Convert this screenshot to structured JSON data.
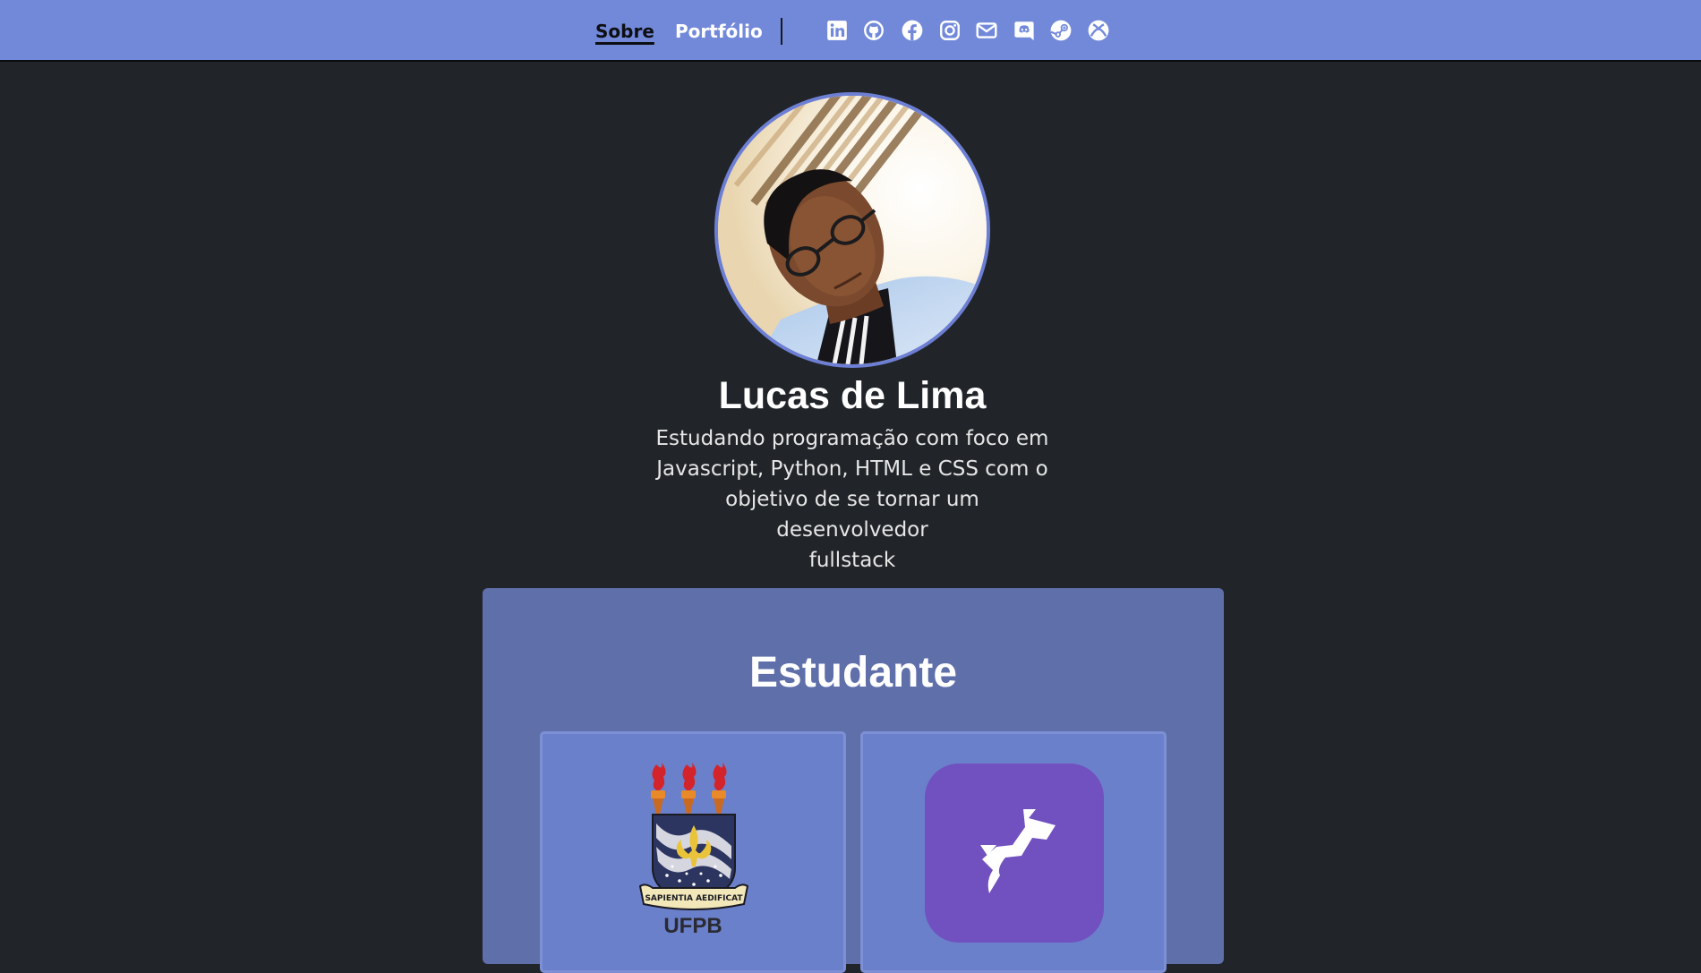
{
  "nav": {
    "links": [
      {
        "label": "Sobre",
        "active": true
      },
      {
        "label": "Portfólio",
        "active": false
      }
    ],
    "social_icons": [
      "linkedin-icon",
      "github-icon",
      "facebook-icon",
      "instagram-icon",
      "mail-icon",
      "discord-icon",
      "steam-icon",
      "xbox-icon"
    ]
  },
  "profile": {
    "name": "Lucas de Lima",
    "bio_lines": [
      "Estudando programação com foco em",
      "Javascript, Python, HTML e CSS com o",
      "objetivo de se tornar um desenvolvedor",
      "fullstack"
    ]
  },
  "section": {
    "title": "Estudante",
    "cards": [
      {
        "logo_text": "UFPB",
        "motto": "SAPIENTIA AEDIFICAT",
        "icon": "ufpb-crest-icon"
      },
      {
        "icon": "rocketseat-logo-icon"
      }
    ]
  },
  "colors": {
    "topbar": "#7289da",
    "page_bg": "#212529",
    "panel_bg": "#5f6faa",
    "tile_bg": "#6b80cb",
    "rocket_bg": "#7150bf"
  }
}
